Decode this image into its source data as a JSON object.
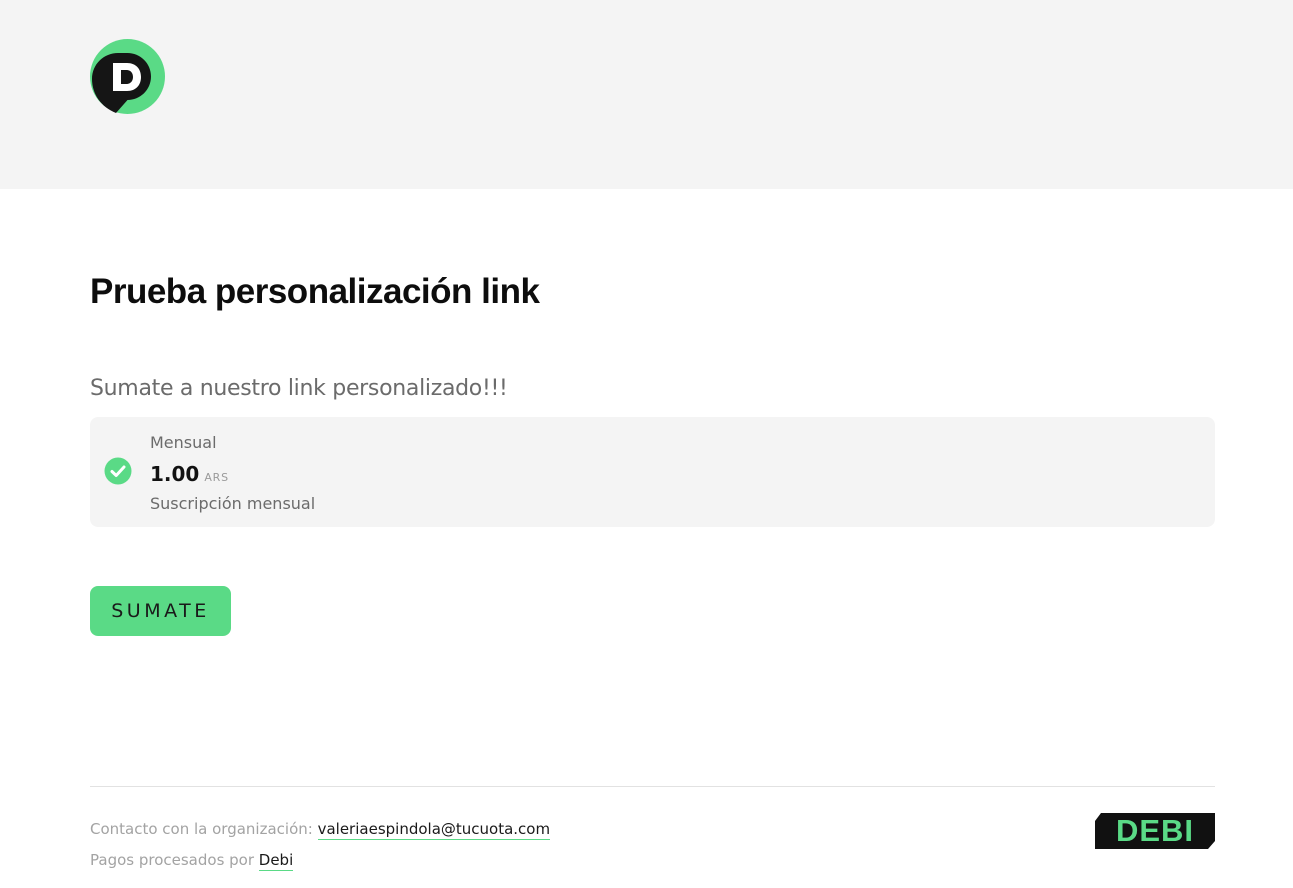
{
  "header": {
    "logo_icon": "debi-d-logo"
  },
  "main": {
    "title": "Prueba personalización link",
    "subtitle": "Sumate a nuestro link personalizado!!!",
    "plan": {
      "name": "Mensual",
      "amount": "1.00",
      "currency": "ARS",
      "description": "Suscripción mensual",
      "selected": true
    },
    "cta_label": "SUMATE"
  },
  "footer": {
    "contact_label": "Contacto con la organización: ",
    "contact_email": "valeriaespindola@tucuota.com",
    "processed_label": "Pagos procesados por ",
    "processed_link": "Debi",
    "brand_logo_text": "DEBI"
  },
  "colors": {
    "accent": "#5ada86",
    "header_bg": "#f4f4f4",
    "card_bg": "#f4f4f4",
    "dark": "#1a1a1a"
  }
}
